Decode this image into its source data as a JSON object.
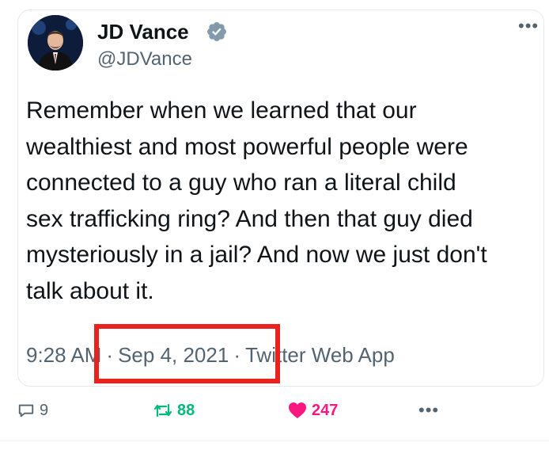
{
  "tweet": {
    "author_name": "JD Vance",
    "handle": "@JDVance",
    "more_glyph": "•••",
    "text": "Remember when we learned that our\nwealthiest and most powerful people were\nconnected to a guy who ran a literal child\nsex trafficking ring? And then that guy died\nmysteriously in a jail? And now we just don't\ntalk about it.",
    "time": "9:28 AM",
    "date": "Sep 4, 2021",
    "separator": "·",
    "source": "Twitter Web App",
    "verified": true,
    "highlight_color": "#e8231f"
  },
  "actions": {
    "reply_count": "9",
    "retweet_count": "88",
    "like_count": "247",
    "more_glyph": "•••",
    "retweet_color": "#00ba7c",
    "like_color": "#f91880",
    "icons": [
      "reply-icon",
      "retweet-icon",
      "heart-icon",
      "more-icon"
    ]
  }
}
